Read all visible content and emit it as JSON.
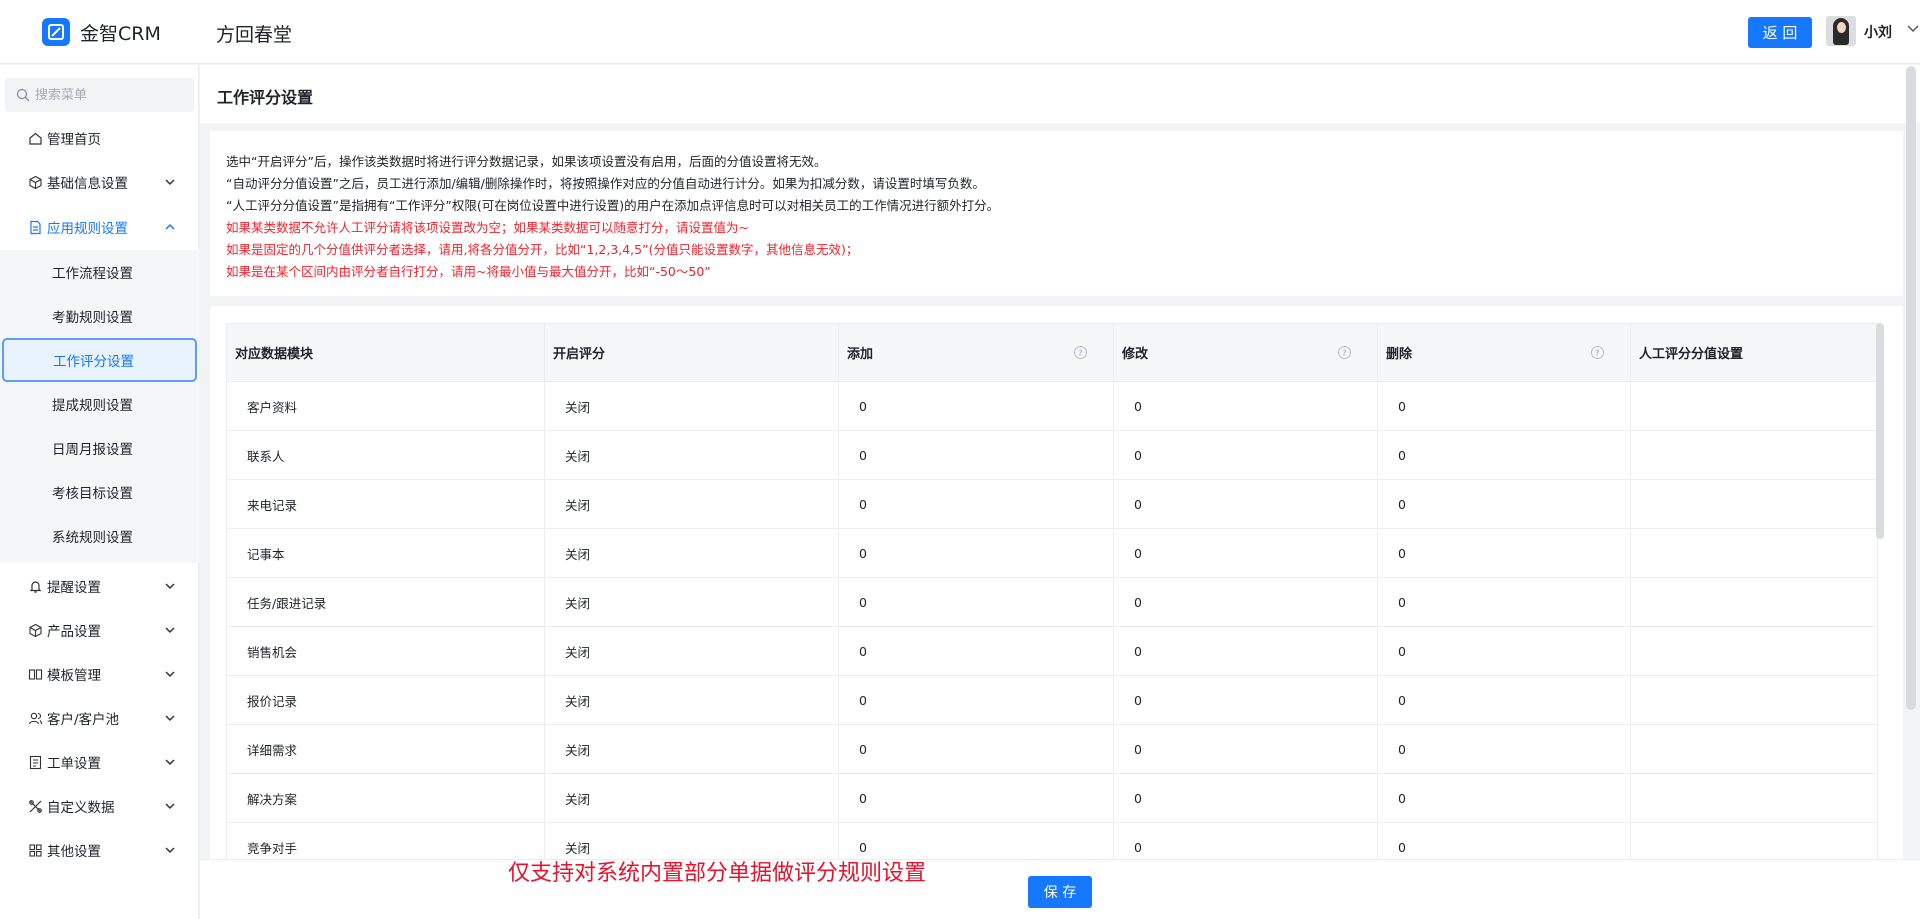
{
  "header": {
    "brand": "金智CRM",
    "company": "方回春堂",
    "back_label": "返 回",
    "user_name": "小刘"
  },
  "sidebar": {
    "search_placeholder": "搜索菜单",
    "items": [
      {
        "label": "管理首页",
        "icon": "home-icon"
      },
      {
        "label": "基础信息设置",
        "icon": "cube-icon"
      },
      {
        "label": "应用规则设置",
        "icon": "document-icon"
      },
      {
        "label": "提醒设置",
        "icon": "bell-icon"
      },
      {
        "label": "产品设置",
        "icon": "cube-icon"
      },
      {
        "label": "模板管理",
        "icon": "template-icon"
      },
      {
        "label": "客户/客户池",
        "icon": "users-icon"
      },
      {
        "label": "工单设置",
        "icon": "ticket-icon"
      },
      {
        "label": "自定义数据",
        "icon": "custom-icon"
      },
      {
        "label": "其他设置",
        "icon": "grid-icon"
      }
    ],
    "sub_items": [
      "工作流程设置",
      "考勤规则设置",
      "工作评分设置",
      "提成规则设置",
      "日周月报设置",
      "考核目标设置",
      "系统规则设置"
    ]
  },
  "page": {
    "title": "工作评分设置"
  },
  "notice": {
    "lines": [
      "选中“开启评分”后，操作该类数据时将进行评分数据记录，如果该项设置没有启用，后面的分值设置将无效。",
      "“自动评分分值设置”之后，员工进行添加/编辑/删除操作时，将按照操作对应的分值自动进行计分。如果为扣减分数，请设置时填写负数。",
      "“人工评分分值设置”是指拥有“工作评分”权限(可在岗位设置中进行设置)的用户在添加点评信息时可以对相关员工的工作情况进行额外打分。"
    ],
    "red_lines": [
      "如果某类数据不允许人工评分请将该项设置改为空；如果某类数据可以随意打分，请设置值为~",
      "如果是固定的几个分值供评分者选择，请用,将各分值分开，比如“1,2,3,4,5”(分值只能设置数字，其他信息无效)；",
      "如果是在某个区间内由评分者自行打分，请用~将最小值与最大值分开，比如“-50～50”"
    ]
  },
  "table": {
    "headers": [
      "对应数据模块",
      "开启评分",
      "添加",
      "修改",
      "删除",
      "人工评分分值设置"
    ],
    "rows": [
      {
        "module": "客户资料",
        "status": "关闭",
        "add": "0",
        "edit": "0",
        "del": "0",
        "manual": ""
      },
      {
        "module": "联系人",
        "status": "关闭",
        "add": "0",
        "edit": "0",
        "del": "0",
        "manual": ""
      },
      {
        "module": "来电记录",
        "status": "关闭",
        "add": "0",
        "edit": "0",
        "del": "0",
        "manual": ""
      },
      {
        "module": "记事本",
        "status": "关闭",
        "add": "0",
        "edit": "0",
        "del": "0",
        "manual": ""
      },
      {
        "module": "任务/跟进记录",
        "status": "关闭",
        "add": "0",
        "edit": "0",
        "del": "0",
        "manual": ""
      },
      {
        "module": "销售机会",
        "status": "关闭",
        "add": "0",
        "edit": "0",
        "del": "0",
        "manual": ""
      },
      {
        "module": "报价记录",
        "status": "关闭",
        "add": "0",
        "edit": "0",
        "del": "0",
        "manual": ""
      },
      {
        "module": "详细需求",
        "status": "关闭",
        "add": "0",
        "edit": "0",
        "del": "0",
        "manual": ""
      },
      {
        "module": "解决方案",
        "status": "关闭",
        "add": "0",
        "edit": "0",
        "del": "0",
        "manual": ""
      },
      {
        "module": "竞争对手",
        "status": "关闭",
        "add": "0",
        "edit": "0",
        "del": "0",
        "manual": ""
      }
    ]
  },
  "footer": {
    "note": "仅支持对系统内置部分单据做评分规则设置",
    "save_label": "保 存"
  },
  "colors": {
    "primary": "#1677ff",
    "warning_text": "#f5222d"
  }
}
